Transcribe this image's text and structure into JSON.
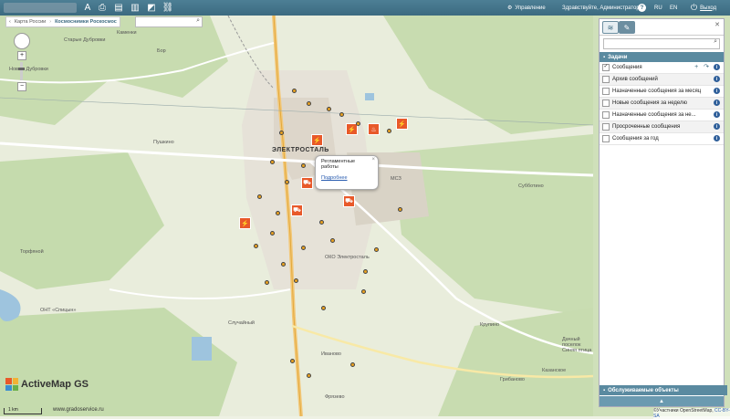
{
  "topbar": {
    "management_label": "Управление",
    "greeting": "Здравствуйте, Администратор",
    "help": "?",
    "lang_ru": "RU",
    "lang_en": "EN",
    "logout": "Выход"
  },
  "breadcrumb": {
    "items": [
      "Карта России",
      "Космоснимки Роскосмос"
    ]
  },
  "panel": {
    "section_tasks": "Задачи",
    "rows": [
      {
        "label": "Сообщения",
        "checked": true
      },
      {
        "label": "Архив сообщений",
        "checked": false
      },
      {
        "label": "Назначенные сообщения за месяц",
        "checked": false
      },
      {
        "label": "Новые сообщения за неделю",
        "checked": false
      },
      {
        "label": "Назначенные сообщения за не...",
        "checked": false
      },
      {
        "label": "Просроченные сообщения",
        "checked": false
      },
      {
        "label": "Сообщения за год",
        "checked": false
      }
    ],
    "section_objects": "Обслуживаемые объекты",
    "collapse": "▲"
  },
  "popup": {
    "title": "Регламентные работы",
    "link": "Подробнее",
    "close": "×"
  },
  "map_labels": {
    "elektrostal": "ЭЛЕКТРОСТАЛЬ",
    "places": [
      {
        "text": "Каменки"
      },
      {
        "text": "Старые Дубровки"
      },
      {
        "text": "Новые Дубровки"
      },
      {
        "text": "Бор"
      },
      {
        "text": "Пушкино"
      },
      {
        "text": "Субботино"
      },
      {
        "text": "Случайный"
      },
      {
        "text": "Иваново"
      },
      {
        "text": "Крупино"
      },
      {
        "text": "Грибаново"
      },
      {
        "text": "Казанское"
      },
      {
        "text": "Фрязево"
      },
      {
        "text": "ОКО Электросталь"
      },
      {
        "text": "МСЗ"
      },
      {
        "text": "Дачный поселок Синяя птица"
      },
      {
        "text": "ОНТ «Спицын»"
      },
      {
        "text": "Торфяной"
      }
    ]
  },
  "branding": {
    "logo_text": "ActiveMap GS",
    "site": "www.gradoservice.ru",
    "scale": "1 km",
    "attribution_prefix": "©Участники OpenStreetMap, ",
    "attribution_license": "CC-BY-SA"
  },
  "colors": {
    "topbar": "#3c6a80",
    "accent": "#5a8aa0",
    "marker": "#e8592a"
  }
}
